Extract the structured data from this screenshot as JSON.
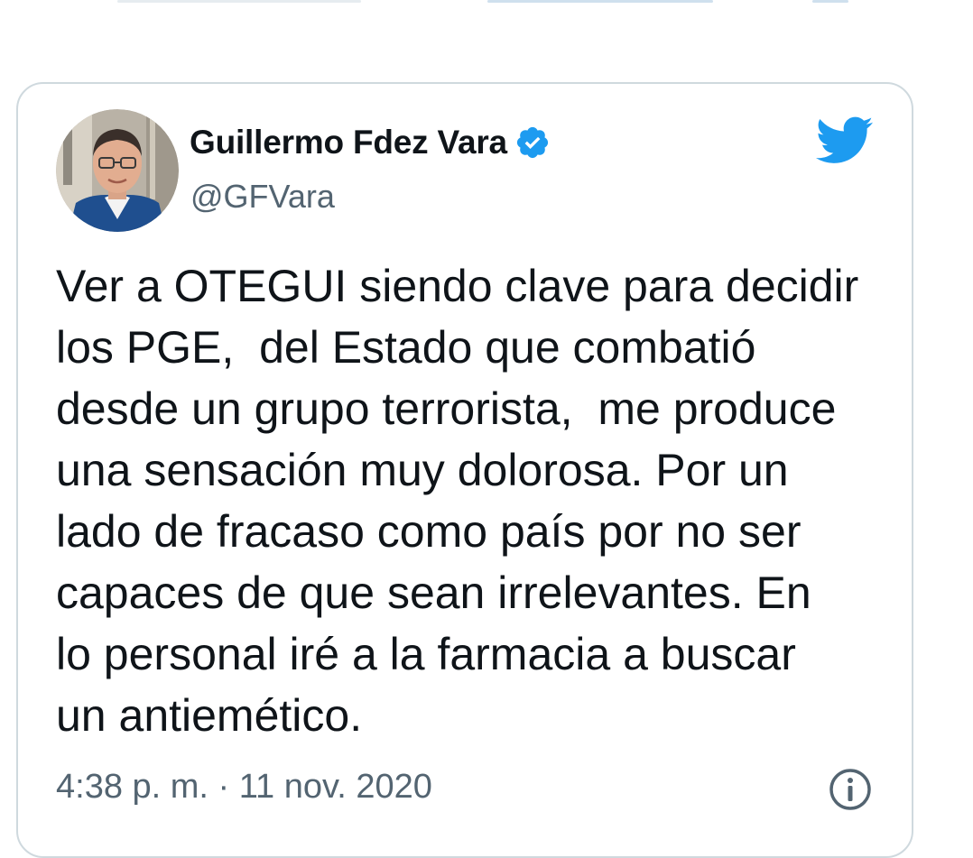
{
  "tweet": {
    "author_name": "Guillermo Fdez Vara",
    "handle": "@GFVara",
    "text": "Ver a OTEGUI siendo clave para decidir\nlos PGE,  del Estado que combatió\ndesde un grupo terrorista,  me produce\nuna sensación muy dolorosa. Por un\nlado de fracaso como país por no ser\ncapaces de que sean irrelevantes. En\nlo personal iré a la farmacia a buscar\nun antiemético.",
    "timestamp": "4:38 p. m. · 11 nov. 2020"
  },
  "icons": {
    "verified": "verified-badge-icon",
    "brand": "twitter-bird-icon",
    "info": "info-icon"
  },
  "colors": {
    "brand_blue": "#1d9bf0",
    "text_primary": "#0f1419",
    "text_secondary": "#536471",
    "card_border": "#cfd9de"
  }
}
